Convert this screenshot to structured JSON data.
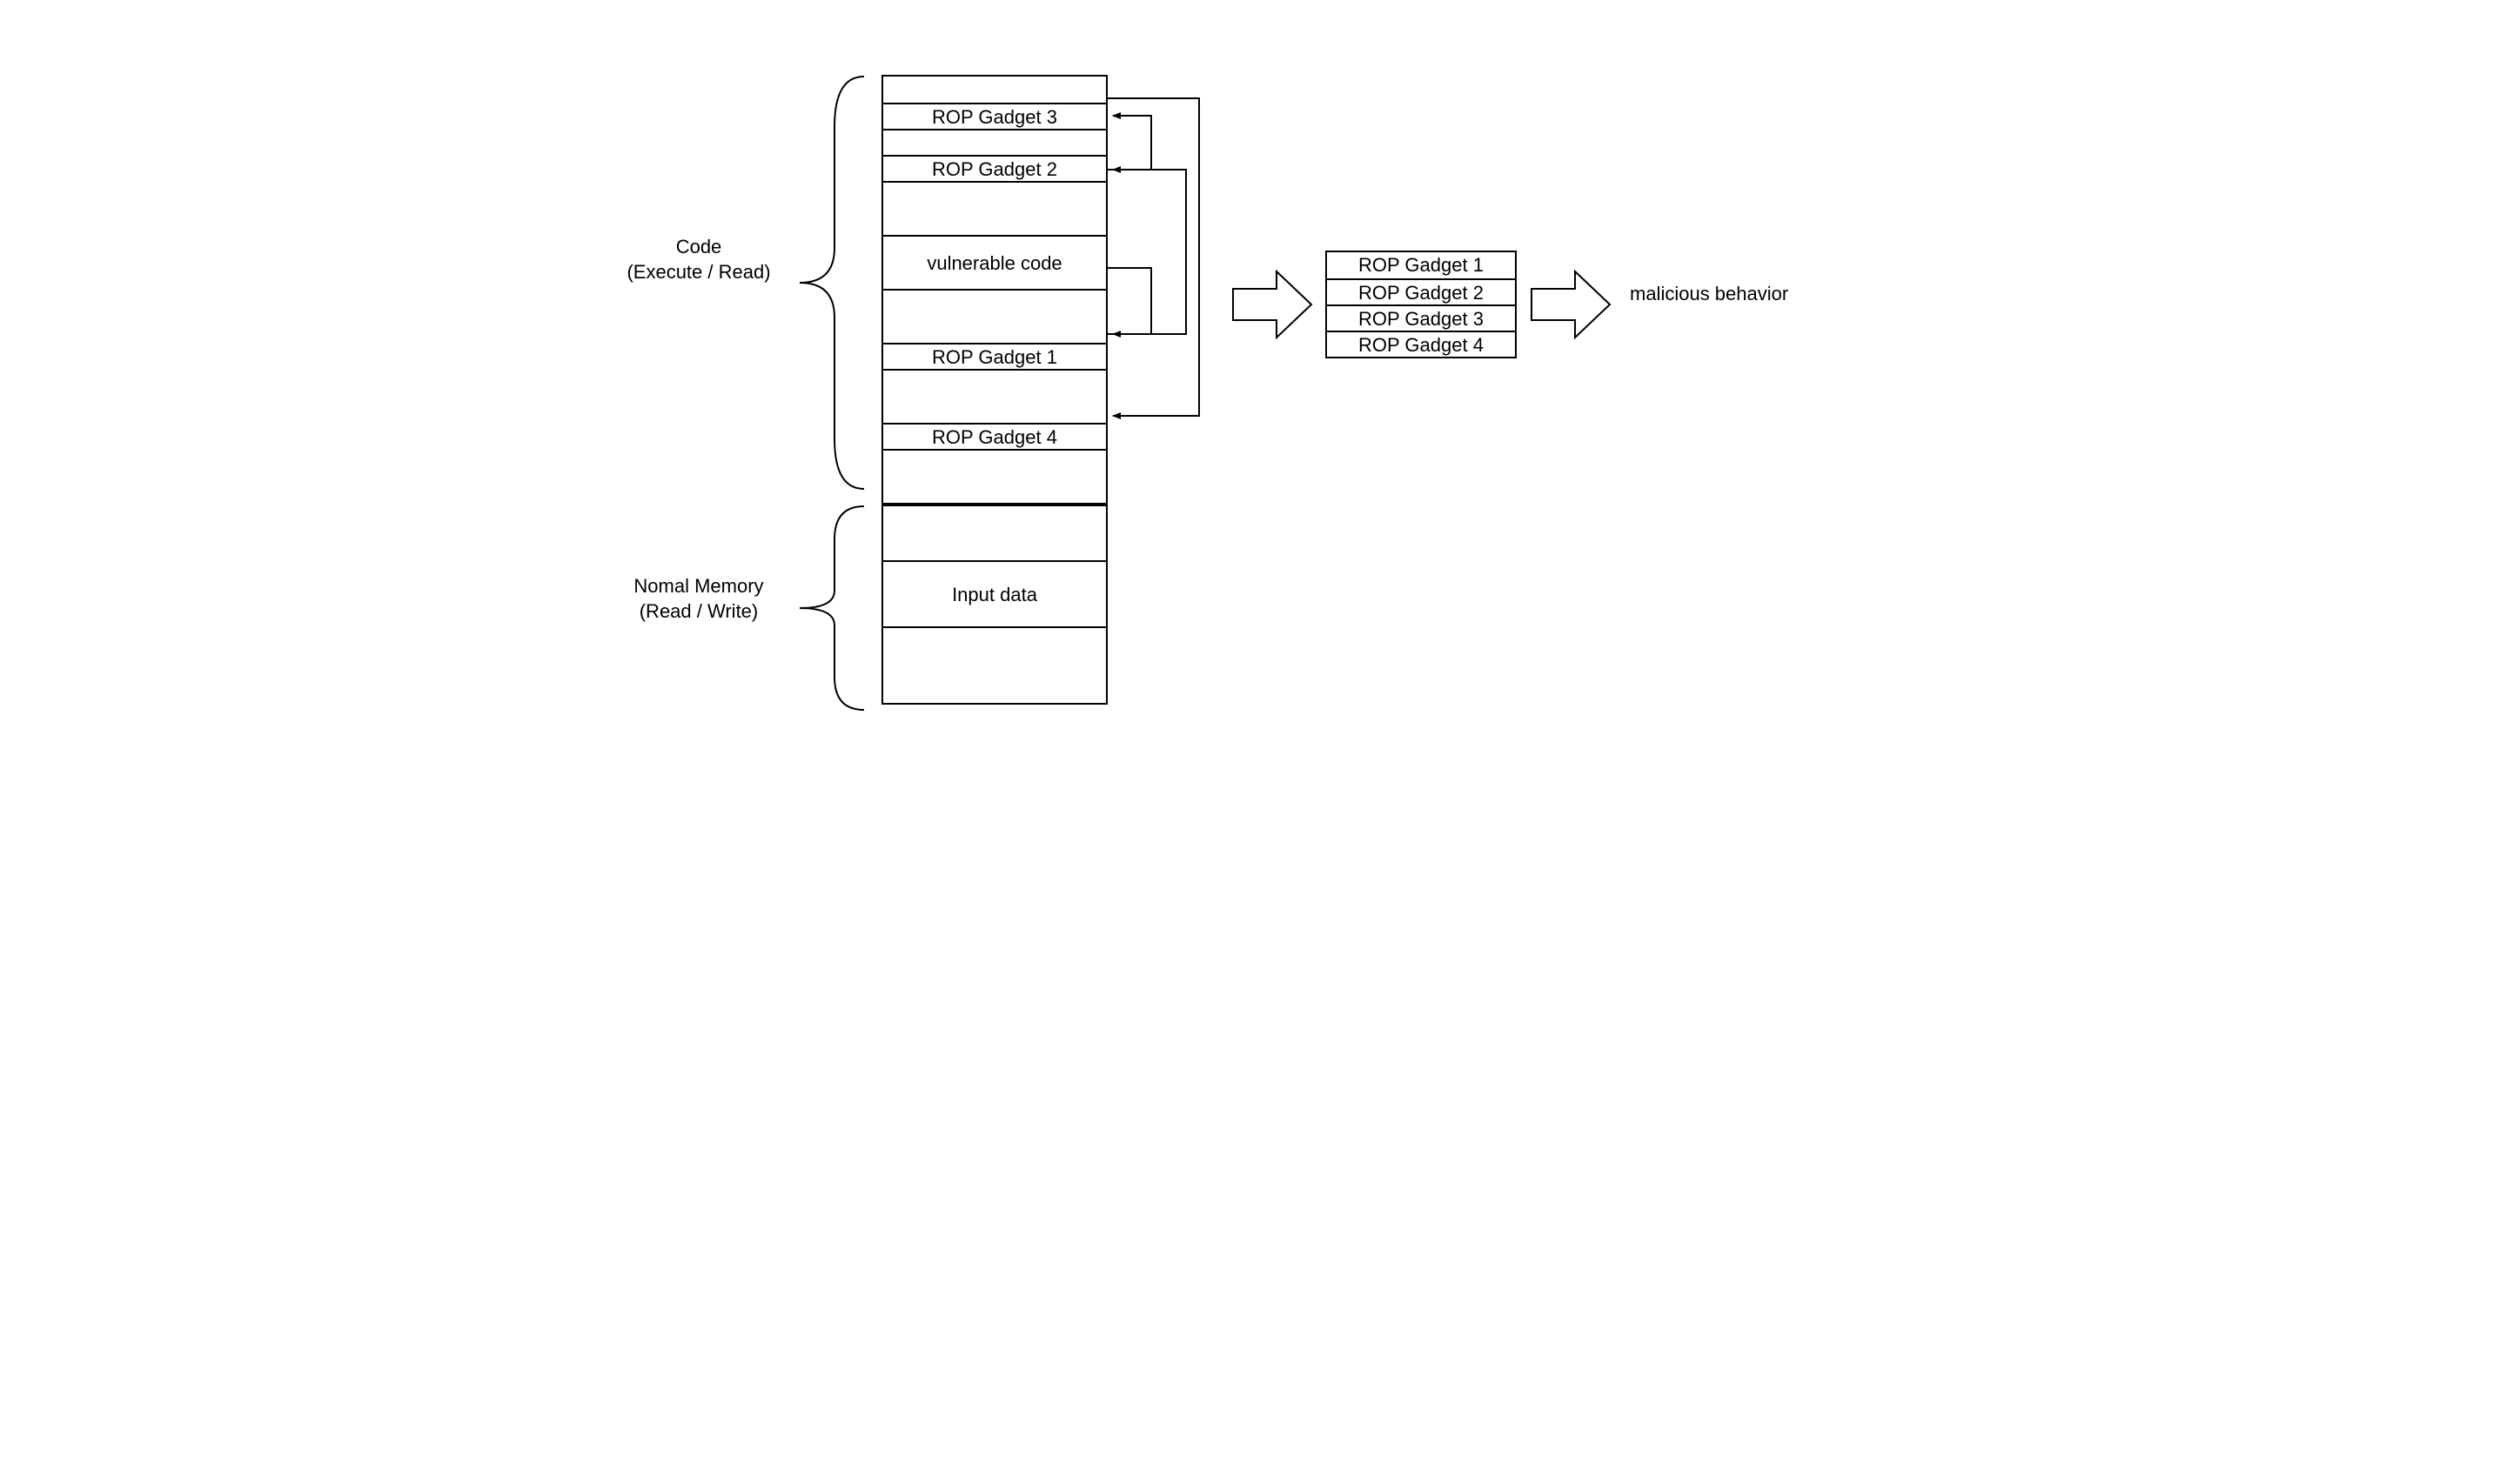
{
  "labels": {
    "code_section": "Code\n(Execute / Read)",
    "memory_section": "Nomal Memory\n(Read / Write)",
    "result": "malicious behavior"
  },
  "code_rows": [
    "",
    "ROP Gadget 3",
    "",
    "ROP Gadget 2",
    "",
    "vulnerable code",
    "",
    "ROP Gadget 1",
    "",
    "ROP Gadget 4",
    ""
  ],
  "memory_rows": [
    "",
    "Input data",
    ""
  ],
  "chain_rows": [
    "ROP Gadget 1",
    "ROP Gadget 2",
    "ROP Gadget 3",
    "ROP Gadget 4"
  ]
}
